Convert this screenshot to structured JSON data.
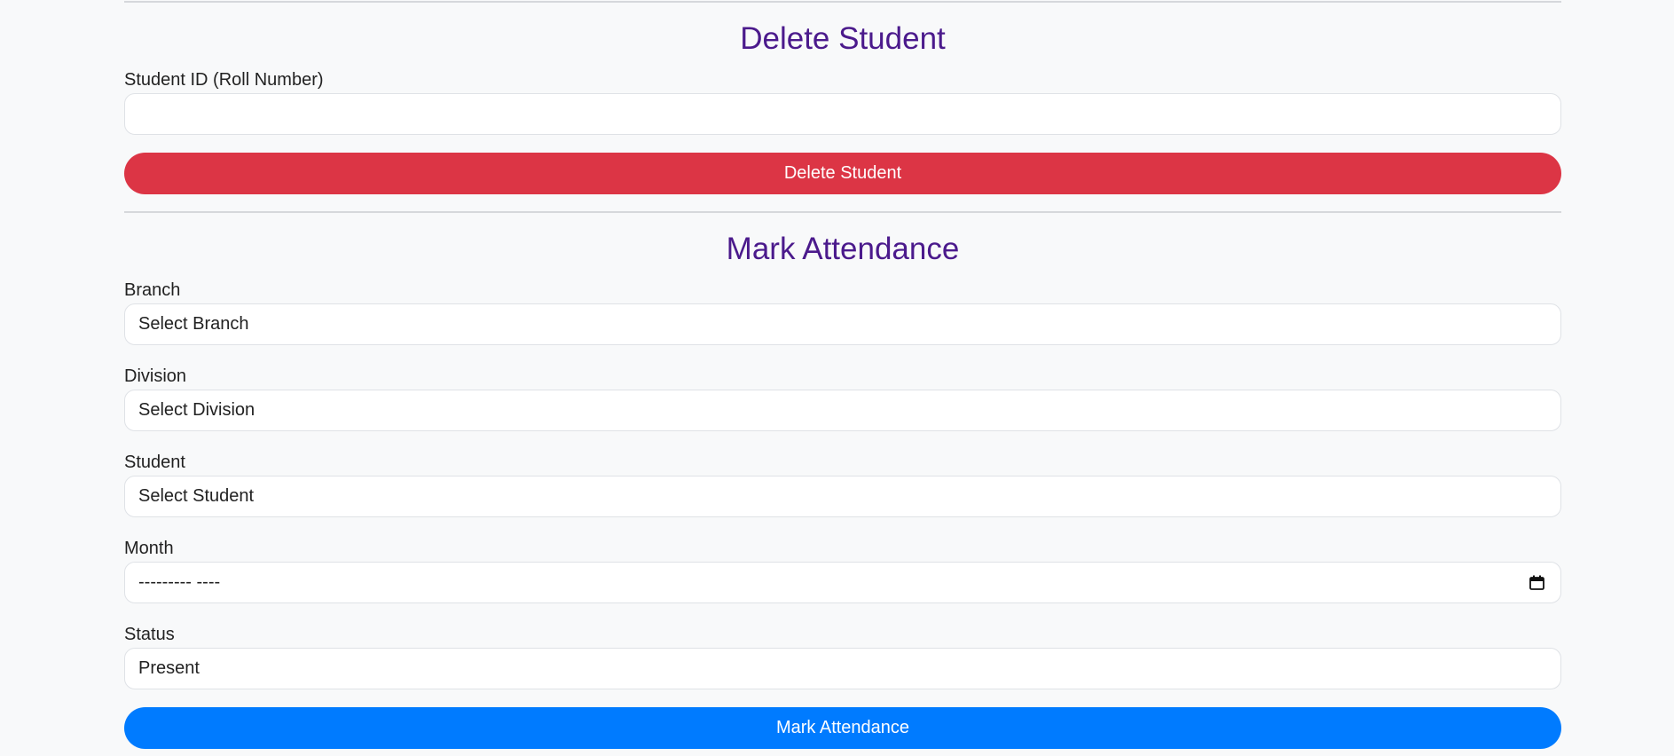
{
  "colors": {
    "heading": "#4b1a8c",
    "delete_button": "#dc3545",
    "attendance_button": "#007bff",
    "page_background": "#f8f9fa"
  },
  "delete_section": {
    "title": "Delete Student",
    "student_id_label": "Student ID (Roll Number)",
    "student_id_value": "",
    "button_label": "Delete Student"
  },
  "attendance_section": {
    "title": "Mark Attendance",
    "branch_label": "Branch",
    "branch_value": "Select Branch",
    "division_label": "Division",
    "division_value": "Select Division",
    "student_label": "Student",
    "student_value": "Select Student",
    "month_label": "Month",
    "month_value": "--------- ----",
    "month_icon": "calendar-icon",
    "status_label": "Status",
    "status_value": "Present",
    "button_label": "Mark Attendance"
  }
}
